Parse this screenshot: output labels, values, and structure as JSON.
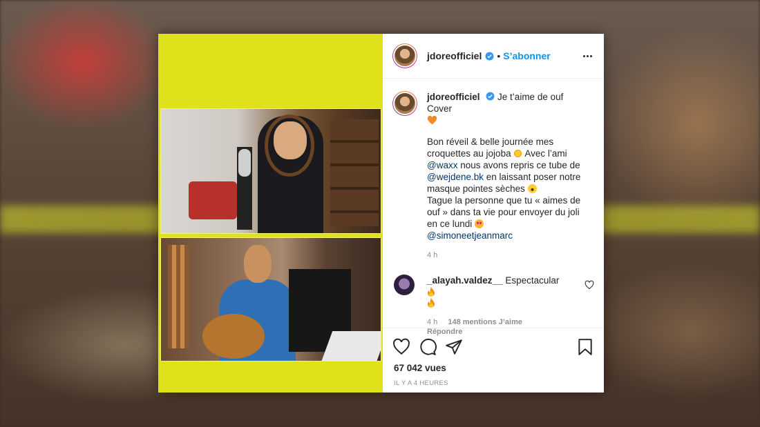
{
  "post": {
    "username": "jdoreofficiel",
    "follow_label": "S’abonner",
    "separator": "•",
    "caption": {
      "title": "Je t’aime de ouf Cover",
      "p1_a": "Bon réveil & belle journée mes croquettes au jojoba",
      "p1_b": "Avec l’ami",
      "mention1": "@waxx",
      "p1_c": "nous avons repris ce tube de",
      "mention2": "@wejdene.bk",
      "p1_d": "en laissant poser notre masque pointes sèches",
      "p2": "Tague la personne que tu « aimes de ouf » dans ta vie pour envoyer du joli en ce lundi",
      "mention3": "@simoneetjeanmarc"
    },
    "caption_time": "4 h",
    "comment": {
      "username": "_alayah.valdez__",
      "text": "Espectacular",
      "time": "4 h",
      "likes": "148 mentions J’aime",
      "reply": "Répondre"
    },
    "views": "67 042 vues",
    "posted_ago": "IL Y A 4 HEURES"
  },
  "colors": {
    "media_bg": "#dfe21a",
    "link_blue": "#0095f6",
    "mention_blue": "#00376b",
    "text": "#262626",
    "muted": "#8e8e8e"
  },
  "icons": [
    "verified-icon",
    "more-options-icon",
    "heart-icon",
    "comment-icon",
    "share-icon",
    "bookmark-icon",
    "sun-emoji",
    "laughing-emoji",
    "heart-eyes-emoji",
    "fire-emoji",
    "orange-heart-emoji"
  ]
}
